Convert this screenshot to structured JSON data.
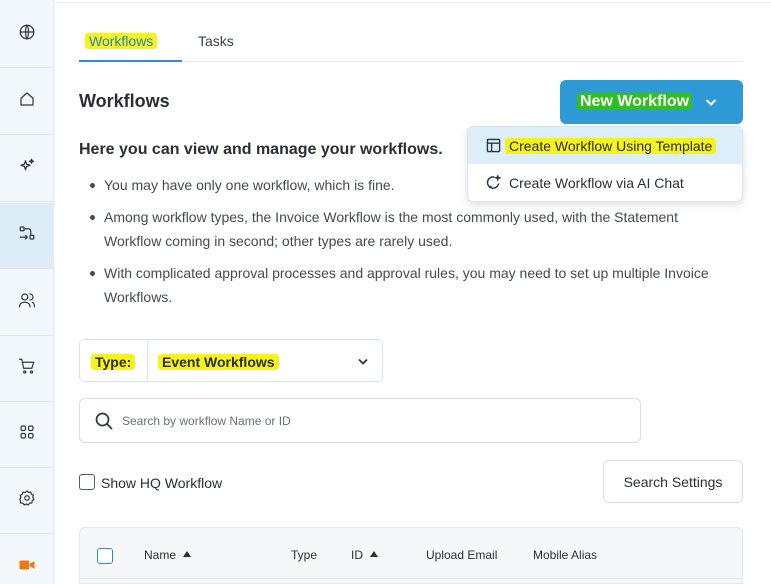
{
  "tabs": [
    {
      "label": "Workflows",
      "active": true
    },
    {
      "label": "Tasks",
      "active": false
    }
  ],
  "sidebar": {
    "items": [
      {
        "icon": "globe-icon"
      },
      {
        "icon": "home-icon"
      },
      {
        "icon": "sparkle-icon"
      },
      {
        "icon": "workflow-icon",
        "active": true
      },
      {
        "icon": "users-icon"
      },
      {
        "icon": "cart-icon"
      },
      {
        "icon": "apps-grid-icon"
      },
      {
        "icon": "gear-icon"
      },
      {
        "icon": "video-camera-icon"
      }
    ]
  },
  "page": {
    "title": "Workflows",
    "new_button_label": "New Workflow"
  },
  "new_menu": {
    "items": [
      {
        "label": "Create Workflow Using Template",
        "icon": "template-icon",
        "highlighted": true
      },
      {
        "label": "Create Workflow via AI Chat",
        "icon": "ai-chat-icon",
        "highlighted": false
      }
    ]
  },
  "intro": {
    "heading": "Here you can view and manage your workflows.",
    "bullets": [
      "You may have only one workflow, which is fine.",
      "Among workflow types, the Invoice Workflow is the most commonly used, with the Statement Workflow coming in second; other types are rarely used.",
      "With complicated approval processes and approval rules, you may need to set up multiple Invoice Workflows."
    ]
  },
  "filter": {
    "type_label": "Type:",
    "type_value": "Event Workflows"
  },
  "search": {
    "placeholder": "Search by workflow Name or ID",
    "value": ""
  },
  "options": {
    "show_hq_label": "Show HQ Workflow",
    "show_hq_checked": false,
    "settings_button_label": "Search Settings"
  },
  "table": {
    "columns": [
      {
        "label": "Name",
        "sort": "asc"
      },
      {
        "label": "Type",
        "sort": null
      },
      {
        "label": "ID",
        "sort": "asc"
      },
      {
        "label": "Upload Email",
        "sort": null
      },
      {
        "label": "Mobile Alias",
        "sort": null
      }
    ]
  },
  "colors": {
    "accent": "#2d9ad6",
    "highlight_yellow": "#f7f21a",
    "highlight_green": "#2fbf1f",
    "sidebar_bg": "#f3f8fc",
    "sidebar_active": "#dcedf8",
    "video_icon": "#f07a12"
  }
}
